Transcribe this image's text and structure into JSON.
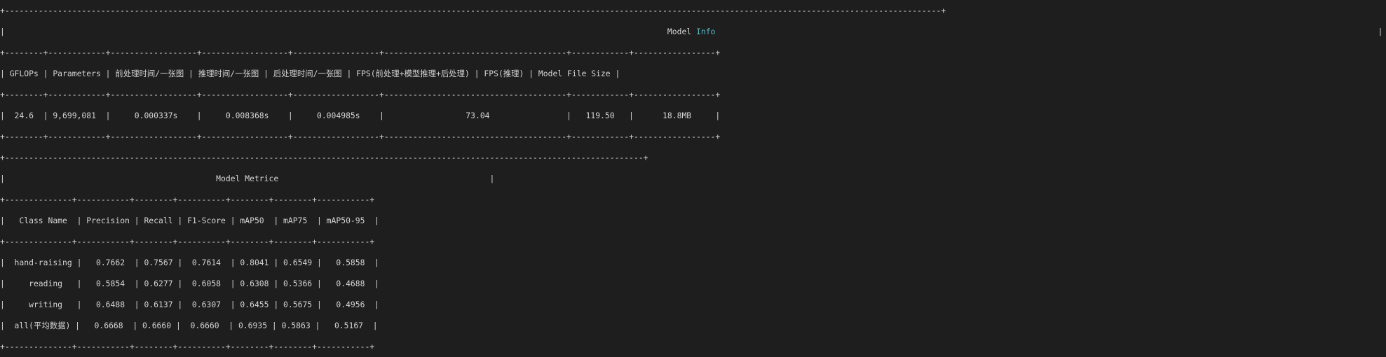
{
  "terminal": {
    "colors": {
      "background": "#1e1e1e",
      "text": "#d4d4d4",
      "highlight": "#56b6c2"
    },
    "lines": [
      [
        "+---------------------------------------------------------------------------------------------------------------------------------------------------------------------------------------------------+"
      ],
      [
        "|                                                                                                                                          ",
        "Model ",
        "Info",
        "                                                                                                                                          |"
      ],
      [
        "+--------+------------+------------------+------------------+------------------+--------------------------------------+------------+-----------------+"
      ],
      [
        "| GFLOPs | Parameters | 前处理时间/一张图 | 推理时间/一张图 | 后处理时间/一张图 | FPS(前处理+模型推理+后处理) | FPS(推理) | Model File Size |"
      ],
      [
        "+--------+------------+------------------+------------------+------------------+--------------------------------------+------------+-----------------+"
      ],
      [
        "|  24.6  | 9,699,081  |     0.000337s    |     0.008368s    |     0.004985s    |                 73.04                |   119.50   |      18.8MB     |"
      ],
      [
        "+--------+------------+------------------+------------------+------------------+--------------------------------------+------------+-----------------+"
      ],
      [
        "+-------------------------------------------------------------------------------------------------------------------------------------+"
      ],
      [
        "|                                            Model Metrice                                            |"
      ],
      [
        "+--------------+-----------+--------+----------+--------+--------+-----------+"
      ],
      [
        "|   Class Name  | Precision | Recall | F1-Score | mAP50  | mAP75  | mAP50-95  |"
      ],
      [
        "+--------------+-----------+--------+----------+--------+--------+-----------+"
      ],
      [
        "|  hand-raising |   0.7662  | 0.7567 |  0.7614  | 0.8041 | 0.6549 |   0.5858  |"
      ],
      [
        "|     reading   |   0.5854  | 0.6277 |  0.6058  | 0.6308 | 0.5366 |   0.4688  |"
      ],
      [
        "|     writing   |   0.6488  | 0.6137 |  0.6307  | 0.6455 | 0.5675 |   0.4956  |"
      ],
      [
        "|  all(平均数据) |   0.6668  | 0.6660 |  0.6660  | 0.6935 | 0.5863 |   0.5167  |"
      ],
      [
        "+--------------+-----------+--------+----------+--------+--------+-----------+"
      ]
    ]
  }
}
